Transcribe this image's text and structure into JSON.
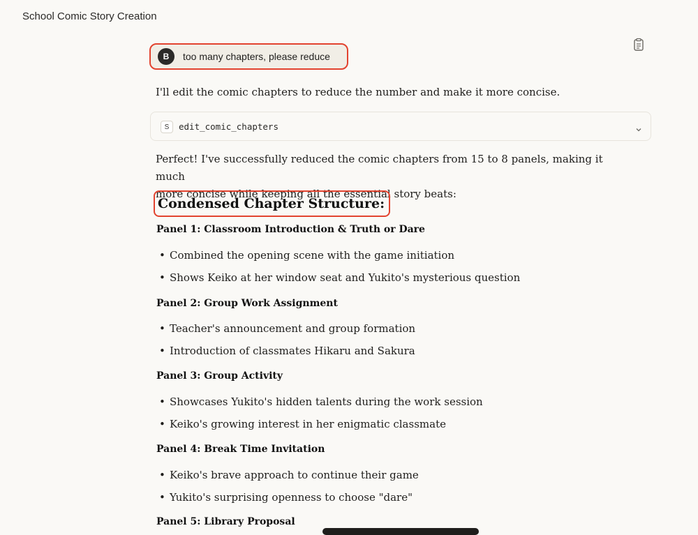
{
  "app": {
    "title": "School Comic Story Creation"
  },
  "user_message": {
    "avatar_initial": "B",
    "text": "too many chapters, please reduce"
  },
  "assistant": {
    "intro": "I'll edit the comic chapters to reduce the number and make it more concise.",
    "tool_call": {
      "badge": "S",
      "name": "edit_comic_chapters"
    },
    "summary_line1": "Perfect! I've successfully reduced the comic chapters from 15 to 8 panels, making it much",
    "summary_line2": "more concise while keeping all the essential story beats:",
    "heading": "Condensed Chapter Structure:",
    "panels": [
      {
        "title": "Panel 1: Classroom Introduction & Truth or Dare",
        "bullets": [
          "Combined the opening scene with the game initiation",
          "Shows Keiko at her window seat and Yukito's mysterious question"
        ]
      },
      {
        "title": "Panel 2: Group Work Assignment",
        "bullets": [
          "Teacher's announcement and group formation",
          "Introduction of classmates Hikaru and Sakura"
        ]
      },
      {
        "title": "Panel 3: Group Activity",
        "bullets": [
          "Showcases Yukito's hidden talents during the work session",
          "Keiko's growing interest in her enigmatic classmate"
        ]
      },
      {
        "title": "Panel 4: Break Time Invitation",
        "bullets": [
          "Keiko's brave approach to continue their game",
          "Yukito's surprising openness to choose \"dare\""
        ]
      },
      {
        "title": "Panel 5: Library Proposal",
        "bullets": []
      }
    ]
  },
  "icons": {
    "copy": "clipboard-icon",
    "expand": "chevron-down-icon"
  },
  "colors": {
    "highlight": "#e2432f",
    "background": "#faf9f6",
    "user_bubble": "#f1eee6"
  }
}
